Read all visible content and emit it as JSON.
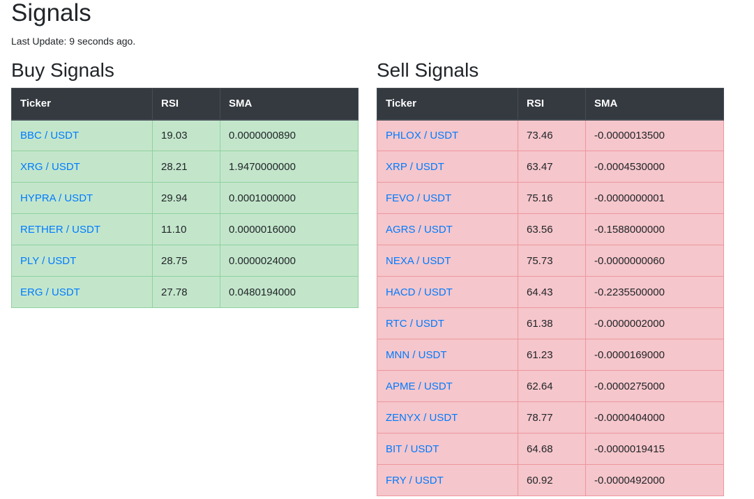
{
  "page": {
    "title": "Signals",
    "last_update": "Last Update: 9 seconds ago."
  },
  "columns": {
    "ticker": "Ticker",
    "rsi": "RSI",
    "sma": "SMA"
  },
  "buy": {
    "title": "Buy Signals",
    "rows": [
      {
        "ticker": "BBC / USDT",
        "rsi": "19.03",
        "sma": "0.0000000890"
      },
      {
        "ticker": "XRG / USDT",
        "rsi": "28.21",
        "sma": "1.9470000000"
      },
      {
        "ticker": "HYPRA / USDT",
        "rsi": "29.94",
        "sma": "0.0001000000"
      },
      {
        "ticker": "RETHER / USDT",
        "rsi": "11.10",
        "sma": "0.0000016000"
      },
      {
        "ticker": "PLY / USDT",
        "rsi": "28.75",
        "sma": "0.0000024000"
      },
      {
        "ticker": "ERG / USDT",
        "rsi": "27.78",
        "sma": "0.0480194000"
      }
    ]
  },
  "sell": {
    "title": "Sell Signals",
    "rows": [
      {
        "ticker": "PHLOX / USDT",
        "rsi": "73.46",
        "sma": "-0.0000013500"
      },
      {
        "ticker": "XRP / USDT",
        "rsi": "63.47",
        "sma": "-0.0004530000"
      },
      {
        "ticker": "FEVO / USDT",
        "rsi": "75.16",
        "sma": "-0.0000000001"
      },
      {
        "ticker": "AGRS / USDT",
        "rsi": "63.56",
        "sma": "-0.1588000000"
      },
      {
        "ticker": "NEXA / USDT",
        "rsi": "75.73",
        "sma": "-0.0000000060"
      },
      {
        "ticker": "HACD / USDT",
        "rsi": "64.43",
        "sma": "-0.2235500000"
      },
      {
        "ticker": "RTC / USDT",
        "rsi": "61.38",
        "sma": "-0.0000002000"
      },
      {
        "ticker": "MNN / USDT",
        "rsi": "61.23",
        "sma": "-0.0000169000"
      },
      {
        "ticker": "APME / USDT",
        "rsi": "62.64",
        "sma": "-0.0000275000"
      },
      {
        "ticker": "ZENYX / USDT",
        "rsi": "78.77",
        "sma": "-0.0000404000"
      },
      {
        "ticker": "BIT / USDT",
        "rsi": "64.68",
        "sma": "-0.0000019415"
      },
      {
        "ticker": "FRY / USDT",
        "rsi": "60.92",
        "sma": "-0.0000492000"
      }
    ]
  },
  "colors": {
    "header_bg": "#343a40",
    "buy_row_bg": "#c3e6cb",
    "sell_row_bg": "#f5c6cb",
    "link": "#007bff"
  }
}
